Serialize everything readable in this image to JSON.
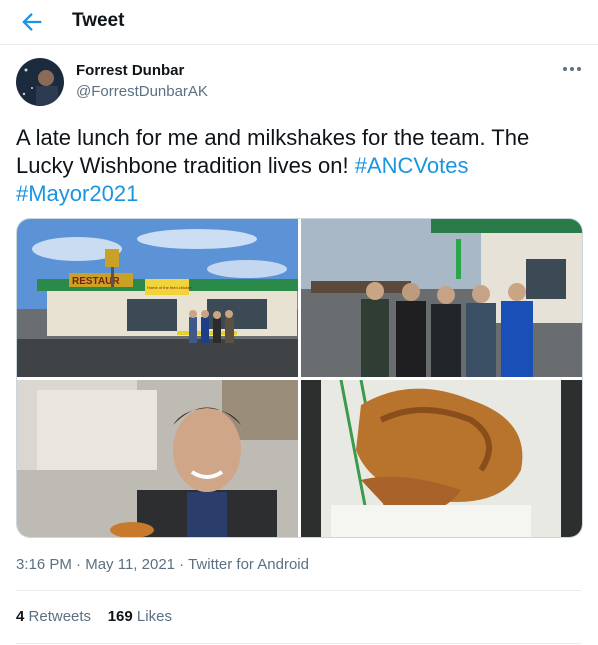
{
  "header": {
    "title": "Tweet"
  },
  "author": {
    "name": "Forrest Dunbar",
    "handle": "@ForrestDunbarAK"
  },
  "tweet": {
    "text_part1": "A late lunch for me and milkshakes for the team. The Lucky Wishbone tradition lives on! ",
    "hashtag1": "#ANCVotes",
    "hashtag2": "#Mayor2021"
  },
  "photos": {
    "photo1_sign_left": "RESTAUR",
    "photo1_sign_right": "Home of the fried chicken"
  },
  "meta": {
    "time": "3:16 PM",
    "date": "May 11, 2021",
    "client": "Twitter for Android",
    "separator": "·"
  },
  "stats": {
    "retweets_count": "4",
    "retweets_label": "Retweets",
    "likes_count": "169",
    "likes_label": "Likes"
  },
  "colors": {
    "accent": "#1b95e0",
    "secondary_text": "#5b7083",
    "divider": "#e6ecf0"
  },
  "icons": {
    "back": "back-arrow-icon",
    "more": "more-icon"
  }
}
